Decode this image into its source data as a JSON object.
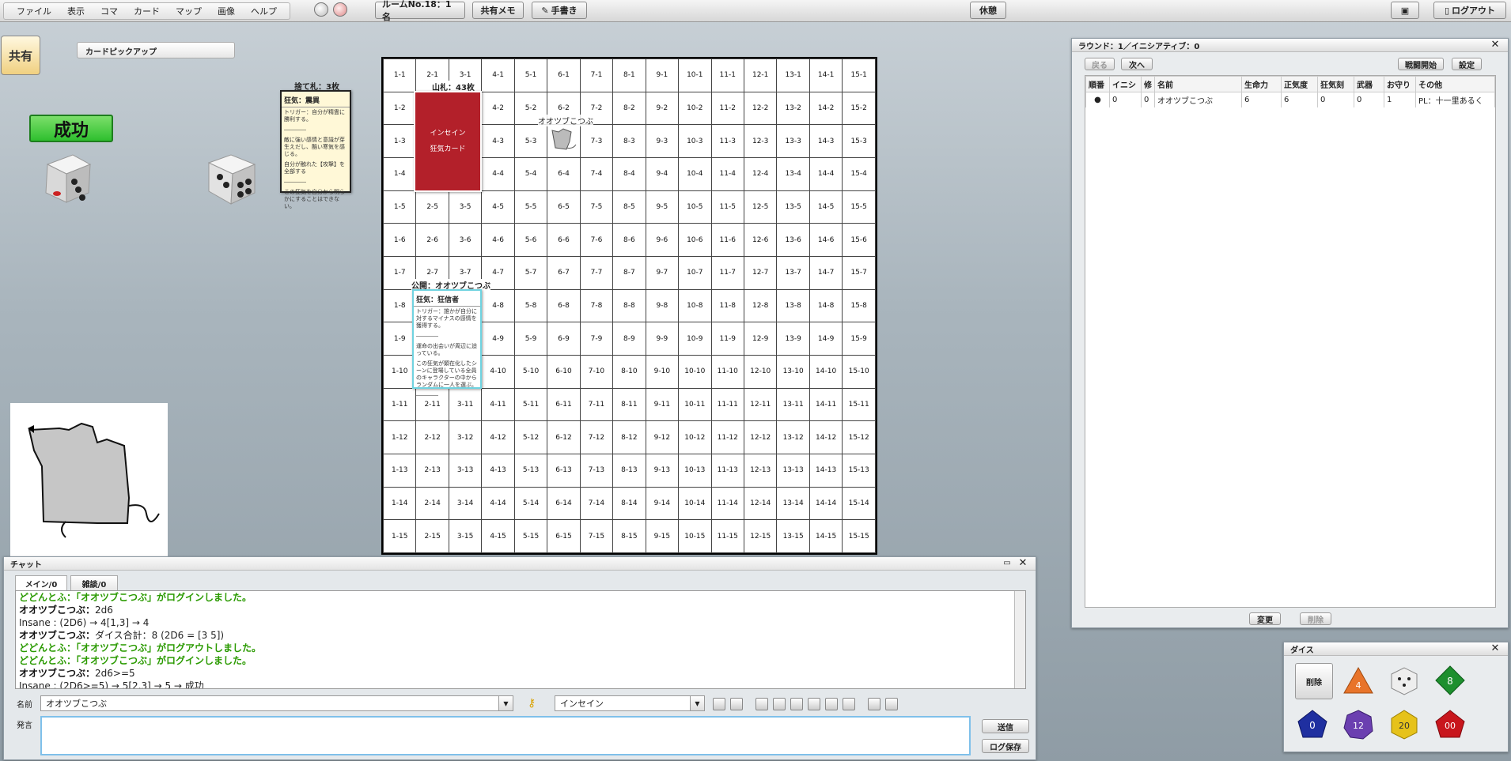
{
  "menu": {
    "items": [
      "ファイル",
      "表示",
      "コマ",
      "カード",
      "マップ",
      "画像",
      "ヘルプ"
    ]
  },
  "toolbar": {
    "room": "ルームNo.18：1名",
    "memo": "共有メモ",
    "handwrite": "手書き",
    "kyukei": "休憩",
    "logout": "ログアウト"
  },
  "share": {
    "label": "共有"
  },
  "pickup": {
    "title": "カードピックアップ"
  },
  "success": {
    "text": "成功"
  },
  "discard": {
    "title": "捨て札：3枚",
    "card_name": "狂気：震異",
    "lines": [
      "トリガー：自分が精霊に勝利する。",
      "――――",
      "敵に強い感情と意識が芽生えだし、酷い寒気を感じる。",
      "自分が触れた【攻撃】を全部する",
      "――――",
      "この狂気を自分から明らかにすることはできない。"
    ]
  },
  "deck": {
    "title": "山札：43枚",
    "line1": "インセイン",
    "line2": "狂気カード"
  },
  "token": {
    "name": "オオツブこつぶ"
  },
  "open_card": {
    "title": "公開：オオツブこつぶ",
    "card_name": "狂気：狂信者",
    "lines": [
      "トリガー：誰かが自分に対するマイナスの感情を獲得する。",
      "――――",
      "運命の出会いが周辺に迫っている。",
      "この狂気が顕在化したシーンに登場している全員のキャラクターの中からランダムに一人を選ぶ。",
      "――――"
    ]
  },
  "board": {
    "cols": 15,
    "rows": 15
  },
  "chat": {
    "title": "チャット",
    "tabs": [
      "メイン/0",
      "雑談/0"
    ],
    "log": [
      {
        "name": "どどんとふ：",
        "text": "「オオツブこつぶ」がログインしました。",
        "style": "green"
      },
      {
        "name": "オオツブこつぶ：",
        "text": "2d6",
        "style": "user"
      },
      {
        "name": "",
        "text": "Insane : (2D6) → 4[1,3] → 4",
        "style": "sys"
      },
      {
        "name": "オオツブこつぶ：",
        "text": "ダイス合計：8 (2D6 = [3 5])",
        "style": "user"
      },
      {
        "name": "どどんとふ：",
        "text": "「オオツブこつぶ」がログアウトしました。",
        "style": "green"
      },
      {
        "name": "どどんとふ：",
        "text": "「オオツブこつぶ」がログインしました。",
        "style": "green"
      },
      {
        "name": "オオツブこつぶ：",
        "text": "2d6>=5",
        "style": "user"
      },
      {
        "name": "",
        "text": "Insane : (2D6>=5) → 5[2,3] → 5 → 成功",
        "style": "sys"
      }
    ],
    "name_label": "名前",
    "name_value": "オオツブこつぶ",
    "system_value": "インセイン",
    "speech_label": "発言",
    "send": "送信",
    "save": "ログ保存"
  },
  "initiative": {
    "title": "ラウンド：1／イニシアティブ：0",
    "back": "戻る",
    "next": "次へ",
    "start": "戦闘開始",
    "settings": "設定",
    "columns": [
      "順番",
      "イニシ",
      "修",
      "名前",
      "生命力",
      "正気度",
      "狂気刻",
      "武器",
      "お守り",
      "その他"
    ],
    "rows": [
      {
        "mark": "●",
        "init": "0",
        "mod": "0",
        "name": "オオツブこつぶ",
        "hp": "6",
        "san": "6",
        "madness": "0",
        "weapon": "0",
        "amulet": "1",
        "other": "PL：十一里あるく"
      }
    ],
    "change": "変更",
    "delete": "削除"
  },
  "dice": {
    "title": "ダイス",
    "delete": "削除",
    "labels": [
      "4",
      "8",
      "0",
      "12",
      "20",
      "00"
    ]
  }
}
